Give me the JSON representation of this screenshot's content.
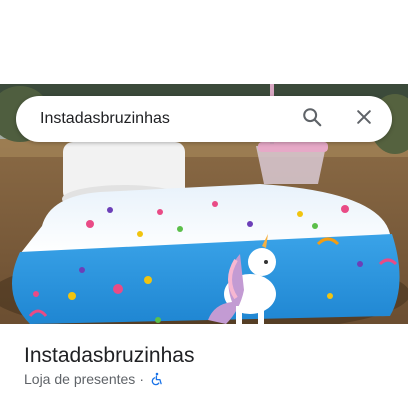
{
  "search": {
    "query": "Instadasbruzinhas"
  },
  "place": {
    "name": "Instadasbruzinhas",
    "category": "Loja de presentes",
    "separator": "·"
  },
  "icons": {
    "search": "search-icon",
    "close": "close-icon",
    "accessibility": "wheelchair-icon"
  },
  "colors": {
    "accessibility_blue": "#1a73e8",
    "icon_gray": "#5f6368",
    "title_text": "#202124"
  }
}
